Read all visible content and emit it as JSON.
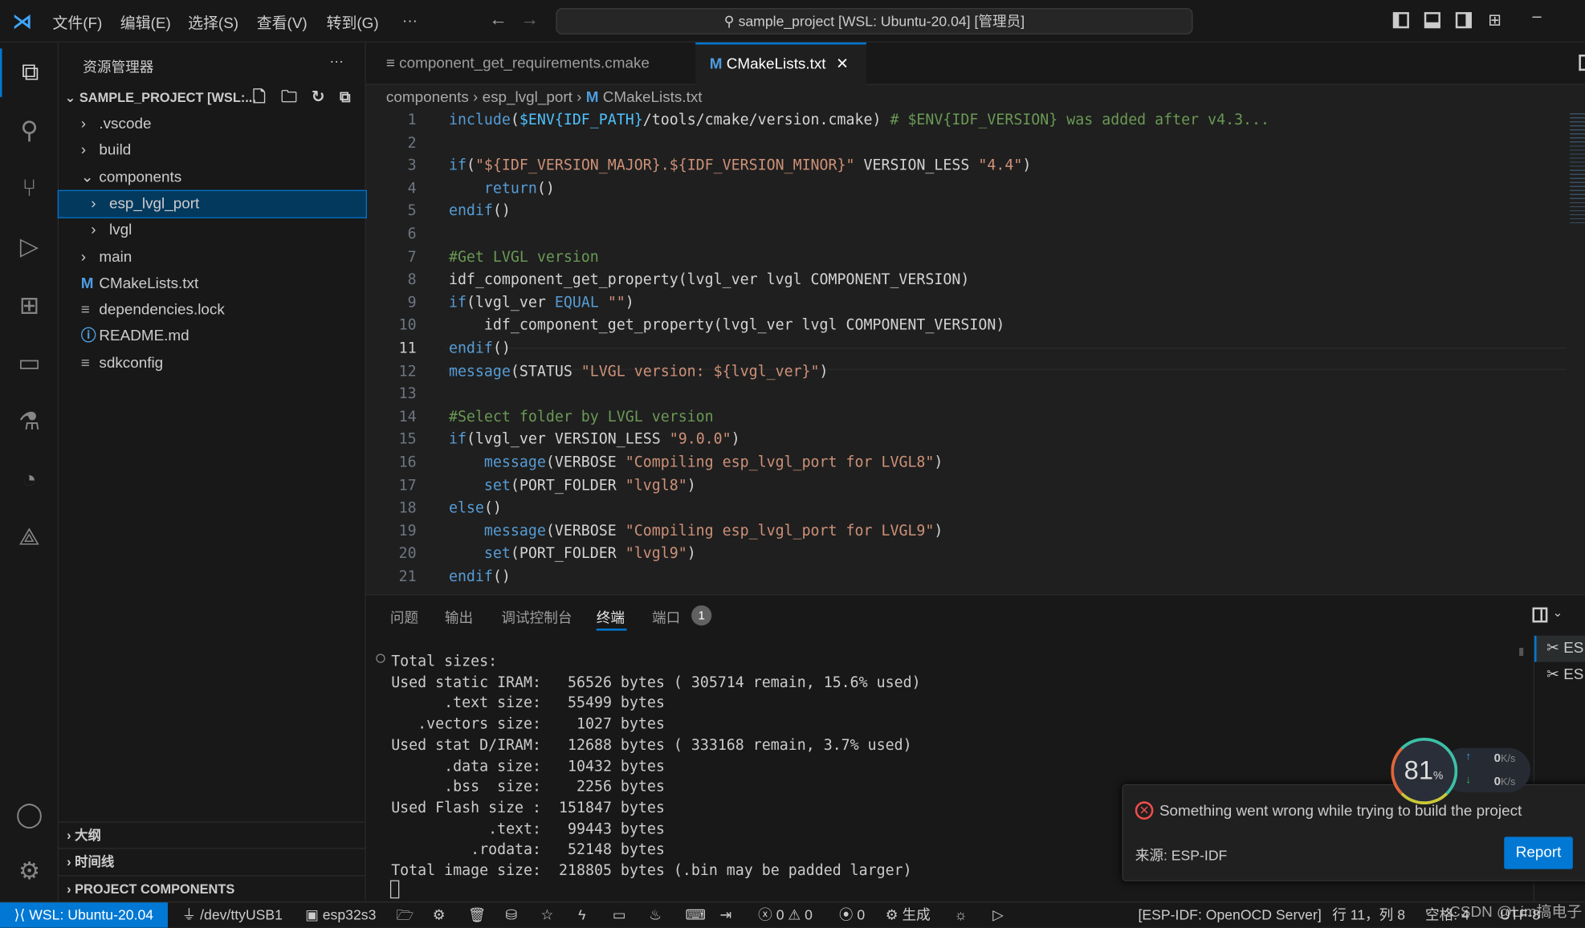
{
  "titlebar": {
    "menus": [
      "文件(F)",
      "编辑(E)",
      "选择(S)",
      "查看(V)",
      "转到(G)",
      "···"
    ],
    "command_center": "sample_project [WSL: Ubuntu-20.04] [管理员]"
  },
  "activity": [
    "files-icon",
    "search-icon",
    "source-control-icon",
    "run-debug-icon",
    "extensions-icon",
    "remote-explorer-icon",
    "testing-icon",
    "espressif-icon",
    "idf-icon"
  ],
  "sidebar": {
    "title": "资源管理器",
    "more": "···",
    "root": "SAMPLE_PROJECT [WSL:...",
    "items": [
      {
        "label": ".vscode",
        "indent": 1,
        "kind": "folder",
        "open": false
      },
      {
        "label": "build",
        "indent": 1,
        "kind": "folder",
        "open": false
      },
      {
        "label": "components",
        "indent": 1,
        "kind": "folder",
        "open": true
      },
      {
        "label": "esp_lvgl_port",
        "indent": 2,
        "kind": "folder",
        "open": false,
        "selected": true
      },
      {
        "label": "lvgl",
        "indent": 2,
        "kind": "folder",
        "open": false
      },
      {
        "label": "main",
        "indent": 1,
        "kind": "folder",
        "open": false
      },
      {
        "label": "CMakeLists.txt",
        "indent": 1,
        "kind": "cmake"
      },
      {
        "label": "dependencies.lock",
        "indent": 1,
        "kind": "text"
      },
      {
        "label": "README.md",
        "indent": 1,
        "kind": "info"
      },
      {
        "label": "sdkconfig",
        "indent": 1,
        "kind": "text"
      }
    ],
    "sections": [
      "大纲",
      "时间线",
      "PROJECT COMPONENTS"
    ]
  },
  "tabs": [
    {
      "label": "component_get_requirements.cmake",
      "active": false
    },
    {
      "label": "CMakeLists.txt",
      "active": true
    }
  ],
  "breadcrumb": [
    "components",
    "esp_lvgl_port",
    "CMakeLists.txt"
  ],
  "editor": {
    "current_line": 11,
    "lines": [
      [
        [
          "include",
          "kw"
        ],
        [
          "(",
          "pl"
        ],
        [
          "$ENV{IDF_PATH}",
          "vr"
        ],
        [
          "/tools/cmake/version.cmake) ",
          "pl"
        ],
        [
          "# $ENV{IDF_VERSION} was added after v4.3...",
          "cm"
        ]
      ],
      [],
      [
        [
          "if",
          "kw"
        ],
        [
          "(",
          "pl"
        ],
        [
          "\"${IDF_VERSION_MAJOR}.${IDF_VERSION_MINOR}\"",
          "st"
        ],
        [
          " VERSION_LESS ",
          "pl"
        ],
        [
          "\"4.4\"",
          "st"
        ],
        [
          ")",
          "pl"
        ]
      ],
      [
        [
          "    ",
          "pl"
        ],
        [
          "return",
          "kw"
        ],
        [
          "()",
          "pl"
        ]
      ],
      [
        [
          "endif",
          "kw"
        ],
        [
          "()",
          "pl"
        ]
      ],
      [],
      [
        [
          "#Get LVGL version",
          "cm"
        ]
      ],
      [
        [
          "idf_component_get_property(lvgl_ver lvgl COMPONENT_VERSION)",
          "pl"
        ]
      ],
      [
        [
          "if",
          "kw"
        ],
        [
          "(lvgl_ver ",
          "pl"
        ],
        [
          "EQUAL",
          "kw"
        ],
        [
          " ",
          "pl"
        ],
        [
          "\"\"",
          "st"
        ],
        [
          ")",
          "pl"
        ]
      ],
      [
        [
          "    idf_component_get_property(lvgl_ver lvgl COMPONENT_VERSION)",
          "pl"
        ]
      ],
      [
        [
          "endif",
          "kw"
        ],
        [
          "()",
          "pl"
        ]
      ],
      [
        [
          "message",
          "kw"
        ],
        [
          "(STATUS ",
          "pl"
        ],
        [
          "\"LVGL version: ${lvgl_ver}\"",
          "st"
        ],
        [
          ")",
          "pl"
        ]
      ],
      [],
      [
        [
          "#Select folder by LVGL version",
          "cm"
        ]
      ],
      [
        [
          "if",
          "kw"
        ],
        [
          "(lvgl_ver VERSION_LESS ",
          "pl"
        ],
        [
          "\"9.0.0\"",
          "st"
        ],
        [
          ")",
          "pl"
        ]
      ],
      [
        [
          "    ",
          "pl"
        ],
        [
          "message",
          "kw"
        ],
        [
          "(VERBOSE ",
          "pl"
        ],
        [
          "\"Compiling esp_lvgl_port for LVGL8\"",
          "st"
        ],
        [
          ")",
          "pl"
        ]
      ],
      [
        [
          "    ",
          "pl"
        ],
        [
          "set",
          "kw"
        ],
        [
          "(PORT_FOLDER ",
          "pl"
        ],
        [
          "\"lvgl8\"",
          "st"
        ],
        [
          ")",
          "pl"
        ]
      ],
      [
        [
          "else",
          "kw"
        ],
        [
          "()",
          "pl"
        ]
      ],
      [
        [
          "    ",
          "pl"
        ],
        [
          "message",
          "kw"
        ],
        [
          "(VERBOSE ",
          "pl"
        ],
        [
          "\"Compiling esp_lvgl_port for LVGL9\"",
          "st"
        ],
        [
          ")",
          "pl"
        ]
      ],
      [
        [
          "    ",
          "pl"
        ],
        [
          "set",
          "kw"
        ],
        [
          "(PORT_FOLDER ",
          "pl"
        ],
        [
          "\"lvgl9\"",
          "st"
        ],
        [
          ")",
          "pl"
        ]
      ],
      [
        [
          "endif",
          "kw"
        ],
        [
          "()",
          "pl"
        ]
      ]
    ]
  },
  "panel": {
    "tabs": [
      "问题",
      "输出",
      "调试控制台",
      "终端",
      "端口"
    ],
    "active_tab": "终端",
    "ports_badge": "1",
    "terminal": [
      "Total sizes:",
      "Used static IRAM:   56526 bytes ( 305714 remain, 15.6% used)",
      "      .text size:   55499 bytes",
      "   .vectors size:    1027 bytes",
      "Used stat D/IRAM:   12688 bytes ( 333168 remain, 3.7% used)",
      "      .data size:   10432 bytes",
      "      .bss  size:    2256 bytes",
      "Used Flash size :  151847 bytes",
      "           .text:   99443 bytes",
      "         .rodata:   52148 bytes",
      "Total image size:  218805 bytes (.bin may be padded larger)"
    ],
    "terminals": [
      "ES",
      "ES"
    ]
  },
  "widget": {
    "cpu": "81",
    "unit": "%",
    "up": "0",
    "down": "0",
    "rate_unit": "K/s"
  },
  "notification": {
    "message": "Something went wrong while trying to build the project",
    "source": "来源: ESP-IDF",
    "button": "Report"
  },
  "status": {
    "remote": "WSL: Ubuntu-20.04",
    "port": "/dev/ttyUSB1",
    "target": "esp32s3",
    "errors": "0",
    "warnings": "0",
    "ports": "0",
    "build": "生成",
    "openocd": "[ESP-IDF: OpenOCD Server]",
    "position": "行 11，列 8",
    "spaces": "空格: 4",
    "encoding": "UTF-8"
  },
  "watermark": "CSDN @Lim搞电子",
  "colors": {
    "accent": "#0078d4",
    "error": "#f14c4c"
  }
}
